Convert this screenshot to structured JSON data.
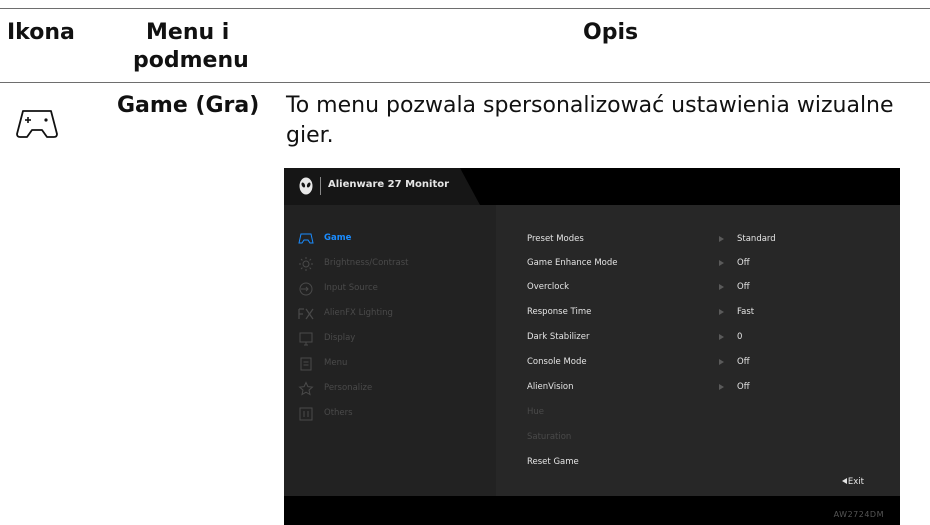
{
  "table": {
    "headers": {
      "icon": "Ikona",
      "menu_line1": "Menu i",
      "menu_line2": "podmenu",
      "desc": "Opis"
    },
    "row": {
      "icon": "gamepad-icon",
      "menu": "Game (Gra)",
      "desc_line1": "To menu pozwala spersonalizować ustawienia wizualne",
      "desc_line2": "gier."
    }
  },
  "osd": {
    "title": "Alienware 27 Monitor",
    "model": "AW2724DM",
    "exit_label": "Exit",
    "accent_color": "#1a8cff",
    "nav": [
      {
        "label": "Game",
        "icon": "gamepad-icon",
        "active": true
      },
      {
        "label": "Brightness/Contrast",
        "icon": "brightness-icon",
        "active": false
      },
      {
        "label": "Input Source",
        "icon": "input-source-icon",
        "active": false
      },
      {
        "label": "AlienFX Lighting",
        "icon": "fx-icon",
        "active": false
      },
      {
        "label": "Display",
        "icon": "display-icon",
        "active": false
      },
      {
        "label": "Menu",
        "icon": "menu-icon",
        "active": false
      },
      {
        "label": "Personalize",
        "icon": "star-icon",
        "active": false
      },
      {
        "label": "Others",
        "icon": "others-icon",
        "active": false
      }
    ],
    "options": [
      {
        "label": "Preset Modes",
        "value": "Standard",
        "enabled": true
      },
      {
        "label": "Game Enhance Mode",
        "value": "Off",
        "enabled": true
      },
      {
        "label": "Overclock",
        "value": "Off",
        "enabled": true
      },
      {
        "label": "Response Time",
        "value": "Fast",
        "enabled": true
      },
      {
        "label": "Dark Stabilizer",
        "value": "0",
        "enabled": true
      },
      {
        "label": "Console Mode",
        "value": "Off",
        "enabled": true
      },
      {
        "label": "AlienVision",
        "value": "Off",
        "enabled": true
      },
      {
        "label": "Hue",
        "value": "",
        "enabled": false
      },
      {
        "label": "Saturation",
        "value": "",
        "enabled": false
      },
      {
        "label": "Reset Game",
        "value": "",
        "enabled": true
      }
    ]
  }
}
